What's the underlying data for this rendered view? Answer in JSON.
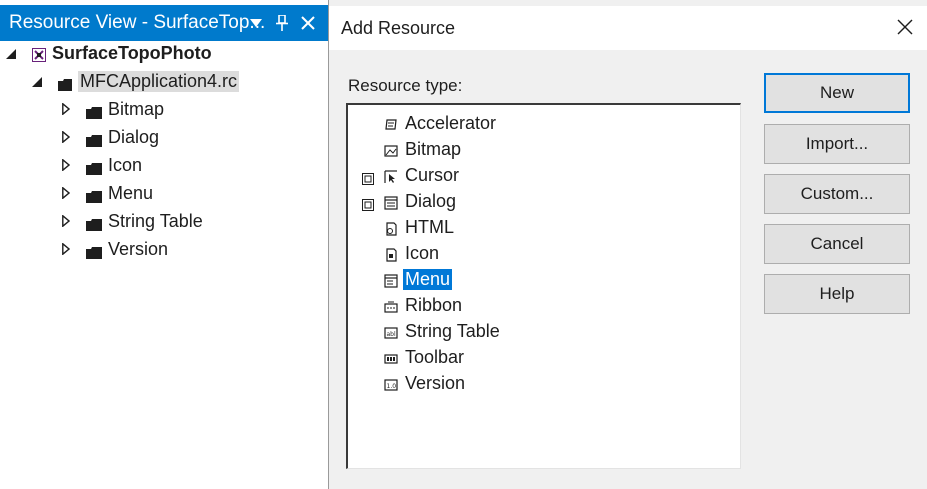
{
  "resource_view": {
    "title": "Resource View - SurfaceTop...",
    "buttons": {
      "dropdown": "▼",
      "pin": "pin",
      "close": "✕"
    },
    "tree": {
      "project": "SurfaceTopoPhoto",
      "rc_file": "MFCApplication4.rc",
      "folders": [
        "Bitmap",
        "Dialog",
        "Icon",
        "Menu",
        "String Table",
        "Version"
      ]
    }
  },
  "dialog": {
    "title": "Add Resource",
    "resource_type_label": "Resource type:",
    "items": [
      {
        "label": "Accelerator",
        "icon": "accelerator-icon",
        "expandable": false
      },
      {
        "label": "Bitmap",
        "icon": "bitmap-icon",
        "expandable": false
      },
      {
        "label": "Cursor",
        "icon": "cursor-icon",
        "expandable": true
      },
      {
        "label": "Dialog",
        "icon": "dialog-icon",
        "expandable": true
      },
      {
        "label": "HTML",
        "icon": "html-icon",
        "expandable": false
      },
      {
        "label": "Icon",
        "icon": "icon-resource-icon",
        "expandable": false
      },
      {
        "label": "Menu",
        "icon": "menu-icon",
        "expandable": false
      },
      {
        "label": "Ribbon",
        "icon": "ribbon-icon",
        "expandable": false
      },
      {
        "label": "String Table",
        "icon": "string-table-icon",
        "expandable": false
      },
      {
        "label": "Toolbar",
        "icon": "toolbar-icon",
        "expandable": false
      },
      {
        "label": "Version",
        "icon": "version-icon",
        "expandable": false
      }
    ],
    "selected_item": "Menu",
    "buttons": {
      "new": "New",
      "import": "Import...",
      "custom": "Custom...",
      "cancel": "Cancel",
      "help": "Help"
    },
    "colors": {
      "selection": "#0078d7",
      "title_bar": "#007acc"
    }
  }
}
